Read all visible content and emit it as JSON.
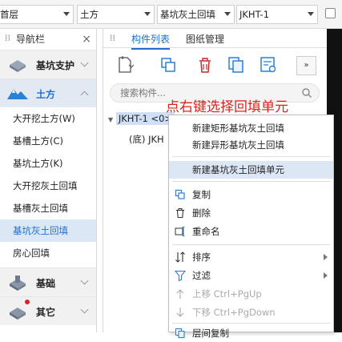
{
  "topbar": {
    "floor": "首层",
    "category": "土方",
    "component_type": "基坑灰土回填",
    "component": "JKHT-1"
  },
  "nav": {
    "title": "导航栏",
    "categories": [
      {
        "label": "基坑支护"
      },
      {
        "label": "土方"
      },
      {
        "label": "基础"
      },
      {
        "label": "其它"
      }
    ],
    "items": [
      {
        "label": "大开挖土方(W)"
      },
      {
        "label": "基槽土方(C)"
      },
      {
        "label": "基坑土方(K)"
      },
      {
        "label": "大开挖灰土回填"
      },
      {
        "label": "基槽灰土回填"
      },
      {
        "label": "基坑灰土回填"
      },
      {
        "label": "房心回填"
      }
    ]
  },
  "panel": {
    "tabs": [
      "构件列表",
      "图纸管理"
    ],
    "search_placeholder": "搜索构件...",
    "more_label": "»",
    "tree": {
      "root": "JKHT-1 <0>",
      "child": "(底) JKH"
    }
  },
  "hint": "点右键选择回填单元",
  "menu": {
    "items": [
      {
        "label": "新建矩形基坑灰土回填"
      },
      {
        "label": "新建异形基坑灰土回填"
      },
      {
        "label": "新建基坑灰土回填单元"
      },
      {
        "label": "复制"
      },
      {
        "label": "删除"
      },
      {
        "label": "重命名"
      },
      {
        "label": "排序"
      },
      {
        "label": "过滤"
      },
      {
        "label": "上移 Ctrl+PgUp"
      },
      {
        "label": "下移 Ctrl+PgDown"
      },
      {
        "label": "层间复制"
      }
    ]
  },
  "colors": {
    "accent": "#1f6fd0",
    "hint_red": "#e0201d",
    "selection": "#dce7f6"
  }
}
